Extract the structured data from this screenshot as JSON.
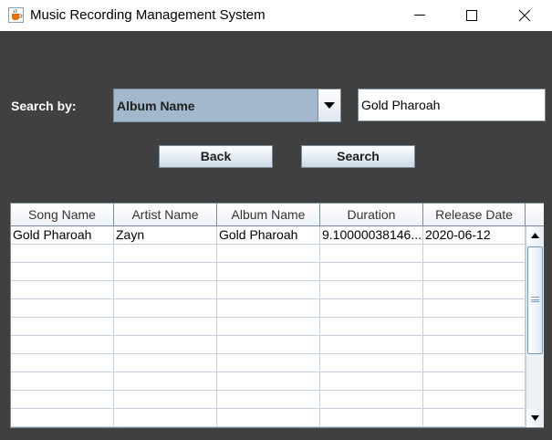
{
  "window": {
    "title": "Music Recording Management System",
    "icon": "java-coffee-cup-icon"
  },
  "search": {
    "label": "Search by:",
    "selected_field": "Album Name",
    "query_value": "Gold Pharoah"
  },
  "buttons": {
    "back": "Back",
    "search": "Search"
  },
  "table": {
    "columns": [
      "Song Name",
      "Artist Name",
      "Album Name",
      "Duration",
      "Release Date"
    ],
    "rows": [
      [
        "Gold Pharoah",
        "Zayn",
        "Gold Pharoah",
        "9.10000038146...",
        "2020-06-12"
      ]
    ]
  },
  "colors": {
    "background": "#404040",
    "combo_selected": "#a3b8cc",
    "border": "#7a8a99"
  }
}
